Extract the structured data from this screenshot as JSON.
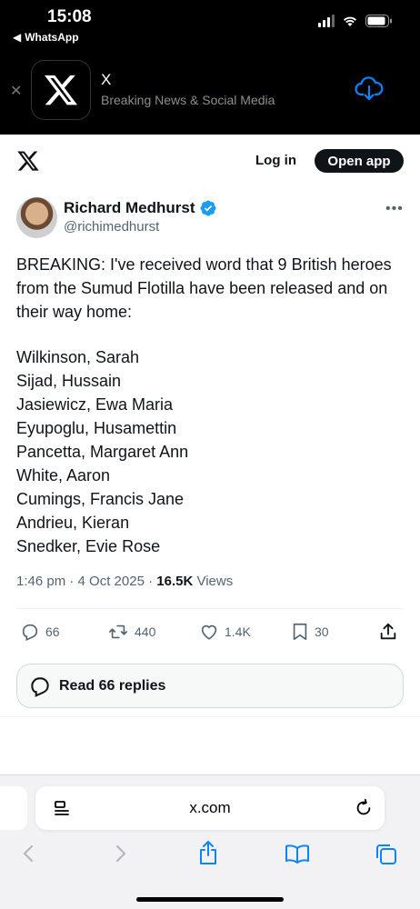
{
  "status_bar": {
    "time": "15:08",
    "back_app": "WhatsApp"
  },
  "app_banner": {
    "app_name": "X",
    "subtitle": "Breaking News & Social Media",
    "get_icon": "cloud-download-icon",
    "accent": "#0a84ff"
  },
  "header": {
    "login_label": "Log in",
    "open_app_label": "Open app"
  },
  "tweet": {
    "author_name": "Richard Medhurst",
    "handle": "@richimedhurst",
    "verified": true,
    "text": "BREAKING: I've received word that 9 British heroes from the Sumud Flotilla have been released and on their way home:",
    "names": [
      "Wilkinson, Sarah",
      "Sijad, Hussain",
      "Jasiewicz, Ewa Maria",
      "Eyupoglu, Husamettin",
      "Pancetta, Margaret Ann",
      "White, Aaron",
      "Cumings, Francis Jane",
      "Andrieu, Kieran",
      "Snedker, Evie Rose"
    ],
    "time": "1:46 pm",
    "date": "4 Oct 2025",
    "views_count": "16.5K",
    "views_label": "Views",
    "replies": "66",
    "reposts": "440",
    "likes": "1.4K",
    "bookmarks": "30",
    "read_replies_label": "Read 66 replies"
  },
  "safari": {
    "url": "x.com"
  },
  "colors": {
    "verified_blue": "#1d9bf0",
    "text": "#0f1419",
    "secondary": "#536471",
    "safari_blue": "#0a84ff"
  }
}
